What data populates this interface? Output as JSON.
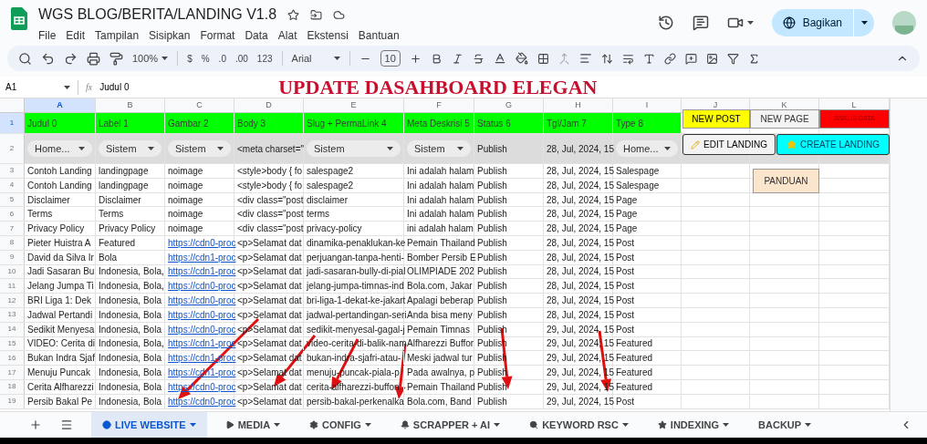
{
  "app": {
    "title": "WGS BLOG/BERITA/LANDING V1.8",
    "menu": [
      "File",
      "Edit",
      "Tampilan",
      "Sisipkan",
      "Format",
      "Data",
      "Alat",
      "Ekstensi",
      "Bantuan"
    ],
    "share_button": "Bagikan"
  },
  "toolbar": {
    "zoom": "100%",
    "format_items": [
      "$",
      "%",
      ".0",
      ".00",
      "123"
    ],
    "font": "Arial",
    "font_size": "10"
  },
  "formula_bar": {
    "cell": "A1",
    "fx": "fx",
    "formula": "Judul 0"
  },
  "banner": "UPDATE DASAHBOARD ELEGAN",
  "columns": [
    {
      "label": "A",
      "selected": true
    },
    {
      "label": "B",
      "selected": false
    },
    {
      "label": "C",
      "selected": false
    },
    {
      "label": "D",
      "selected": false
    },
    {
      "label": "E",
      "selected": false
    },
    {
      "label": "F",
      "selected": false
    },
    {
      "label": "G",
      "selected": false
    },
    {
      "label": "H",
      "selected": false
    },
    {
      "label": "I",
      "selected": false
    },
    {
      "label": "J",
      "selected": false
    },
    {
      "label": "K",
      "selected": false
    },
    {
      "label": "L",
      "selected": false
    }
  ],
  "rows": [
    {
      "number": "1",
      "selected": true,
      "kind": "header",
      "cells": [
        "Judul 0",
        "Label 1",
        "Gambar 2",
        "Body 3",
        "Slug + PermaLink 4",
        "Meta Deskrisi 5",
        "Status 6",
        "Tgl/Jam 7",
        "Type 8"
      ]
    },
    {
      "number": "2",
      "selected": false,
      "kind": "filter",
      "cells": [
        {
          "kind": "dropdown",
          "text": "Home..."
        },
        {
          "kind": "dropdown",
          "text": "Sistem"
        },
        {
          "kind": "dropdown",
          "text": "Sistem"
        },
        "<meta charset=\"",
        {
          "kind": "dropdown",
          "text": "Sistem"
        },
        {
          "kind": "dropdown",
          "text": "Sistem"
        },
        "Publish",
        "28, Jul, 2024, 15",
        {
          "kind": "dropdown",
          "text": "Home..."
        }
      ]
    },
    {
      "number": "3",
      "selected": false,
      "kind": "data",
      "cells": [
        "Contoh Landing",
        "landingpage",
        "noimage",
        "<style>body { fo",
        "salespage2",
        "Ini adalah halam",
        "Publish",
        "28, Jul, 2024, 15",
        "Salespage"
      ]
    },
    {
      "number": "4",
      "selected": false,
      "kind": "data",
      "cells": [
        "Contoh Landing",
        "landingpage",
        "noimage",
        "<style>body { fo",
        "salespage2",
        "Ini adalah halam",
        "Publish",
        "28, Jul, 2024, 15",
        "Salespage"
      ]
    },
    {
      "number": "5",
      "selected": false,
      "kind": "data",
      "cells": [
        "Disclaimer",
        "Disclaimer",
        "noimage",
        "<div class=\"post",
        "disclaimer",
        "Ini adalah halam",
        "Publish",
        "28, Jul, 2024, 15",
        "Page"
      ]
    },
    {
      "number": "6",
      "selected": false,
      "kind": "data",
      "cells": [
        "Terms",
        "Terms",
        "noimage",
        "<div class=\"post",
        "terms",
        "Ini adalah halam",
        "Publish",
        "28, Jul, 2024, 15",
        "Page"
      ]
    },
    {
      "number": "7",
      "selected": false,
      "kind": "data",
      "cells": [
        "Privacy Policy",
        "Privacy Policy",
        "noimage",
        "<div class=\"post",
        "privacy-policy",
        "ini adalah halam",
        "Publish",
        "28, Jul, 2024, 15",
        "Page"
      ]
    },
    {
      "number": "8",
      "selected": false,
      "kind": "data",
      "cells": [
        "Pieter Huistra A",
        "Featured",
        {
          "kind": "link",
          "text": "https://cdn0-proc"
        },
        "<p>Selamat dat",
        "dinamika-penaklukan-ke",
        "Pemain Thailand",
        "Publish",
        "28, Jul, 2024, 15",
        "Post"
      ]
    },
    {
      "number": "9",
      "selected": false,
      "kind": "data",
      "cells": [
        "David da Silva Ir",
        "Bola",
        {
          "kind": "link",
          "text": "https://cdn1-proc"
        },
        "<p>Selamat dat",
        "perjuangan-tanpa-henti-",
        "Bomber Persib E",
        "Publish",
        "28, Jul, 2024, 15",
        "Post"
      ]
    },
    {
      "number": "10",
      "selected": false,
      "kind": "data",
      "cells": [
        "Jadi Sasaran Bu",
        "Indonesia, Bola,",
        {
          "kind": "link",
          "text": "https://cdn1-proc"
        },
        "<p>Selamat dat",
        "jadi-sasaran-bully-di-pial",
        "OLIMPIADE 202",
        "Publish",
        "28, Jul, 2024, 15",
        "Post"
      ]
    },
    {
      "number": "11",
      "selected": false,
      "kind": "data",
      "cells": [
        "Jelang Jumpa Ti",
        "Indonesia, Bola,",
        {
          "kind": "link",
          "text": "https://cdn0-proc"
        },
        "<p>Selamat dat",
        "jelang-jumpa-timnas-ind",
        "Bola.com, Jakar",
        "Publish",
        "28, Jul, 2024, 15",
        "Post"
      ]
    },
    {
      "number": "12",
      "selected": false,
      "kind": "data",
      "cells": [
        "BRI Liga 1: Dek",
        "Indonesia, Bola",
        {
          "kind": "link",
          "text": "https://cdn0-proc"
        },
        "<p>Selamat dat",
        "bri-liga-1-dekat-ke-jakart",
        "Apalagi beberap",
        "Publish",
        "28, Jul, 2024, 15",
        "Post"
      ]
    },
    {
      "number": "13",
      "selected": false,
      "kind": "data",
      "cells": [
        "Jadwal Pertandi",
        "Indonesia, Bola",
        {
          "kind": "link",
          "text": "https://cdn0-proc"
        },
        "<p>Selamat dat",
        "jadwal-pertandingan-seri",
        "Anda bisa meny",
        "Publish",
        "28, Jul, 2024, 15",
        "Post"
      ]
    },
    {
      "number": "14",
      "selected": false,
      "kind": "data",
      "cells": [
        "Sedikit Menyesa",
        "Indonesia, Bola",
        {
          "kind": "link",
          "text": "https://cdn0-proc"
        },
        "<p>Selamat dat",
        "sedikit-menyesal-gagal-j",
        "Pemain Timnas",
        "Publish",
        "29, Jul, 2024, 15",
        "Post"
      ]
    },
    {
      "number": "15",
      "selected": false,
      "kind": "data",
      "cells": [
        "VIDEO: Cerita di",
        "Indonesia, Bola,",
        {
          "kind": "link",
          "text": "https://cdn1-proc"
        },
        "<p>Selamat dat",
        "video-cerita-di-balik-nam",
        "Alfharezzi Buffor",
        "Publish",
        "29, Jul, 2024, 15",
        "Featured"
      ]
    },
    {
      "number": "16",
      "selected": false,
      "kind": "data",
      "cells": [
        "Bukan Indra Sjaf",
        "Indonesia, Bola",
        {
          "kind": "link",
          "text": "https://cdn1-proc"
        },
        "<p>Selamat dat",
        "bukan-indra-sjafri-atau-",
        "Meski jadwal tur",
        "Publish",
        "29, Jul, 2024, 15",
        "Featured"
      ]
    },
    {
      "number": "17",
      "selected": false,
      "kind": "data",
      "cells": [
        "Menuju Puncak",
        "Indonesia, Bola",
        {
          "kind": "link",
          "text": "https://cdn1-proc"
        },
        "<p>Selamat dat",
        "menuju-puncak-piala-p",
        "Pada awalnya, p",
        "Publish",
        "29, Jul, 2024, 15",
        "Featured"
      ]
    },
    {
      "number": "18",
      "selected": false,
      "kind": "data",
      "cells": [
        "Cerita Alfharezzi",
        "Indonesia, Bola",
        {
          "kind": "link",
          "text": "https://cdn0-proc"
        },
        "<p>Selamat dat",
        "cerita-alfharezzi-buffon",
        "Pemain Thailand",
        "Publish",
        "29, Jul, 2024, 15",
        "Featured"
      ]
    },
    {
      "number": "19",
      "selected": false,
      "kind": "data",
      "cells": [
        "Persib Bakal Pe",
        "Indonesia, Bola",
        {
          "kind": "link",
          "text": "https://cdn0-proc"
        },
        "<p>Selamat dat",
        "persib-bakal-perkenalka",
        "Bola.com, Band",
        "Publish",
        "29, Jul, 2024, 15",
        "Post"
      ]
    }
  ],
  "buttons": [
    {
      "label": "NEW POST",
      "color": "#ffff00"
    },
    {
      "label": "NEW PAGE",
      "color": "#f3f3f3"
    },
    {
      "label": "ANALIS DATA",
      "color": "#ff0000"
    },
    {
      "label": "EDIT LANDING",
      "color": "#f3f3f3"
    },
    {
      "label": "CREATE LANDING",
      "color": "#00ffff"
    },
    {
      "label": "PANDUAN",
      "color": "#fce5cd"
    }
  ],
  "sheet_tabs": [
    {
      "label": "LIVE WEBSITE",
      "selected": true
    },
    {
      "label": "MEDIA",
      "selected": false
    },
    {
      "label": "CONFIG",
      "selected": false
    },
    {
      "label": "SCRAPPER + AI",
      "selected": false
    },
    {
      "label": "KEYWORD RSC",
      "selected": false
    },
    {
      "label": "INDEXING",
      "selected": false
    },
    {
      "label": "BACKUP",
      "selected": false
    }
  ]
}
